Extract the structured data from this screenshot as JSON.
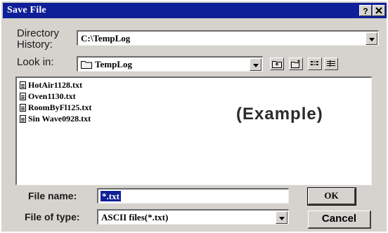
{
  "window": {
    "title": "Save File",
    "help_label": "?",
    "close_label": "X"
  },
  "directory_history": {
    "label": "Directory\nHistory:",
    "value": "C:\\TempLog"
  },
  "look_in": {
    "label": "Look in:",
    "value": "TempLog"
  },
  "toolbar": {
    "icons": [
      "up-one-level-icon",
      "create-new-folder-icon",
      "list-view-icon",
      "details-view-icon"
    ]
  },
  "files": [
    {
      "name": "HotAir1128.txt"
    },
    {
      "name": "Oven1130.txt"
    },
    {
      "name": "RoomByFl125.txt"
    },
    {
      "name": "Sin Wave0928.txt"
    }
  ],
  "example_label": "(Example)",
  "file_name": {
    "label": "File name:",
    "value": "*.txt"
  },
  "file_type": {
    "label": "File of type:",
    "value": "ASCII files(*.txt)"
  },
  "buttons": {
    "ok": "OK",
    "cancel": "Cancel"
  },
  "colors": {
    "titlebar": "#0f1f98",
    "face": "#d6d3ce",
    "selection": "#0f1f98"
  }
}
